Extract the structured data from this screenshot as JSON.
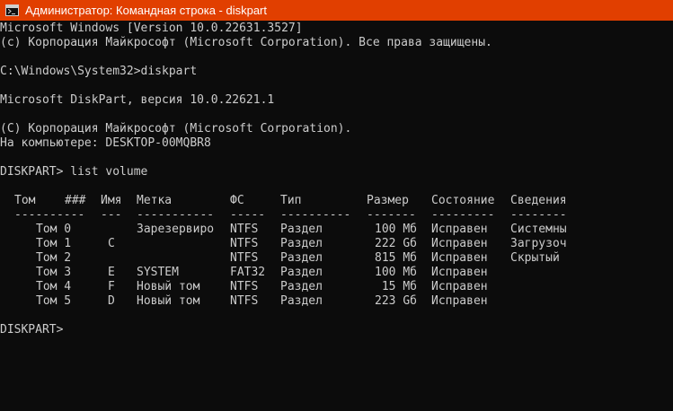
{
  "window": {
    "title": "Администратор: Командная строка - diskpart",
    "titlebar_color": "#e13f00",
    "background_color": "#0c0c0c",
    "text_color": "#cccccc"
  },
  "console": {
    "header_lines": [
      "Microsoft Windows [Version 10.0.22631.3527]",
      "(c) Корпорация Майкрософт (Microsoft Corporation). Все права защищены."
    ],
    "prompt_command": "C:\\Windows\\System32>diskpart",
    "diskpart_version": "Microsoft DiskPart, версия 10.0.22621.1",
    "copyright": "(C) Корпорация Майкрософт (Microsoft Corporation).",
    "computer": "На компьютере: DESKTOP-00MQBR8",
    "list_command": "DISKPART> list volume",
    "final_prompt": "DISKPART> "
  },
  "volume_table": {
    "headers": [
      "Том",
      "###",
      "Имя",
      "Метка",
      "ФС",
      "Тип",
      "Размер",
      "Состояние",
      "Сведения"
    ],
    "separators": [
      "----------",
      "---",
      "-----------",
      "-----",
      "----------",
      "-------",
      "---------",
      "--------"
    ],
    "rows": [
      [
        "Том 0",
        "",
        "Зарезервиро",
        "NTFS",
        "Раздел",
        "100 Мб",
        "Исправен",
        "Системны"
      ],
      [
        "Том 1",
        "C",
        "",
        "NTFS",
        "Раздел",
        "222 Gб",
        "Исправен",
        "Загрузоч"
      ],
      [
        "Том 2",
        "",
        "",
        "NTFS",
        "Раздел",
        "815 Мб",
        "Исправен",
        "Скрытый"
      ],
      [
        "Том 3",
        "E",
        "SYSTEM",
        "FAT32",
        "Раздел",
        "100 Мб",
        "Исправен",
        ""
      ],
      [
        "Том 4",
        "F",
        "Новый том",
        "NTFS",
        "Раздел",
        "15 Мб",
        "Исправен",
        ""
      ],
      [
        "Том 5",
        "D",
        "Новый том",
        "NTFS",
        "Раздел",
        "223 Gб",
        "Исправен",
        ""
      ]
    ]
  }
}
